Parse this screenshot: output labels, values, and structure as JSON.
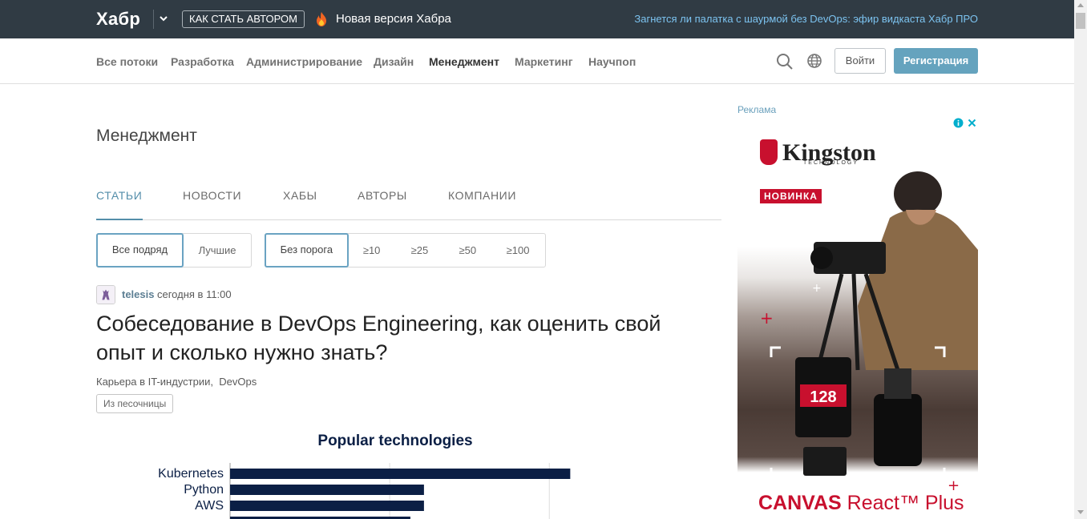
{
  "topbar": {
    "logo": "Хабр",
    "author_button": "КАК СТАТЬ АВТОРОМ",
    "new_version": "Новая версия Хабра",
    "promo_link": "Загнется ли палатка с шаурмой без DevOps: эфир видкаста Хабр ПРО"
  },
  "nav": {
    "items": [
      "Все потоки",
      "Разработка",
      "Администрирование",
      "Дизайн",
      "Менеджмент",
      "Маркетинг",
      "Научпоп"
    ],
    "active": "Менеджмент",
    "login": "Войти",
    "register": "Регистрация"
  },
  "hub": {
    "title": "Менеджмент",
    "tabs": [
      "СТАТЬИ",
      "НОВОСТИ",
      "ХАБЫ",
      "АВТОРЫ",
      "КОМПАНИИ"
    ],
    "active_tab": "СТАТЬИ"
  },
  "filters": {
    "sort": [
      "Все подряд",
      "Лучшие"
    ],
    "sort_selected": "Все подряд",
    "threshold": [
      "Без порога",
      "≥10",
      "≥25",
      "≥50",
      "≥100"
    ],
    "threshold_selected": "Без порога"
  },
  "post": {
    "author": "telesis",
    "time": "сегодня в 11:00",
    "title": "Собеседование в DevOps Engineering, как оценить свой опыт и сколько нужно знать?",
    "hubs": [
      "Карьера в IT-индустрии",
      "DevOps"
    ],
    "badge": "Из песочницы"
  },
  "chart_data": {
    "type": "bar",
    "title": "Popular technologies",
    "categories": [
      "Kubernetes",
      "Python",
      "AWS"
    ],
    "values": [
      100,
      57,
      57
    ],
    "partially_visible_value": 53,
    "orientation": "horizontal",
    "xlim": [
      0,
      122
    ],
    "bar_color": "#0b1f45",
    "grid": true
  },
  "ad": {
    "label": "Реклама",
    "brand": "Kingston",
    "brand_sub": "TECHNOLOGY",
    "badge": "НОВИНКА",
    "product_bold": "CANVAS",
    "product_rest": " React™ Plus",
    "accent": "#c8102e"
  },
  "colors": {
    "topbar_bg": "#303b44",
    "accent": "#548eaa",
    "register_bg": "#65a3be",
    "promo": "#7cc3f0"
  }
}
